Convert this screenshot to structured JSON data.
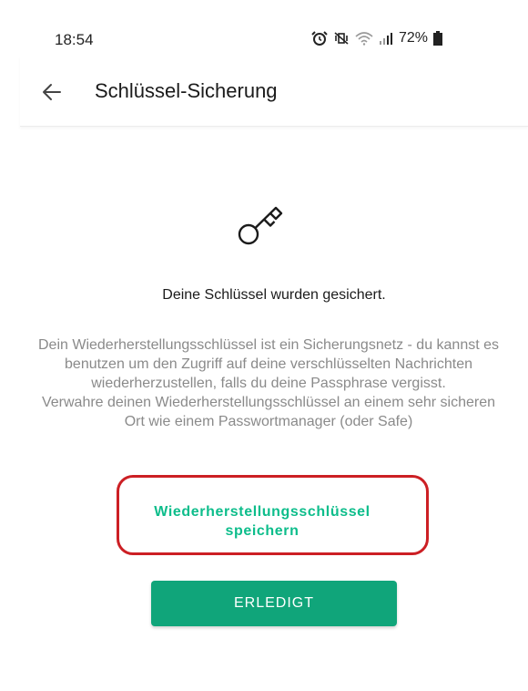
{
  "status_bar": {
    "time": "18:54",
    "battery": "72%",
    "icons": [
      "alarm-icon",
      "mute-vibrate-icon",
      "wifi-icon",
      "signal-icon",
      "battery-icon"
    ]
  },
  "app_bar": {
    "title": "Schlüssel-Sicherung",
    "back_icon": "arrow-left-icon"
  },
  "content": {
    "icon": "key-icon",
    "headline": "Deine Schlüssel wurden gesichert.",
    "description_1": "Dein Wiederherstellungsschlüssel ist ein Sicherungsnetz - du kannst es benutzen um den Zugriff auf deine verschlüsselten Nachrichten wiederherzustellen, falls du deine Passphrase vergisst.",
    "description_2": "Verwahre deinen Wiederherstellungsschlüssel an einem sehr sicheren Ort wie einem Passwortmanager (oder Safe)",
    "save_key_label": "Wiederherstellungsschlüssel speichern",
    "done_label": "ERLEDIGT"
  },
  "colors": {
    "accent": "#0dbd8b",
    "button": "#10a57a",
    "highlight": "#cc1f24",
    "secondary_text": "#8a8a8a"
  }
}
